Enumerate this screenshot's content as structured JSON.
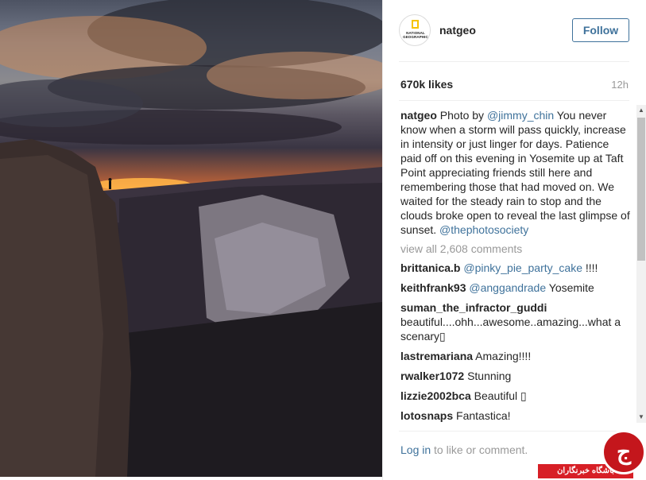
{
  "post": {
    "username": "natgeo",
    "avatar_label": "NATIONAL GEOGRAPHIC",
    "follow_label": "Follow",
    "likes": "670k likes",
    "time_ago": "12h"
  },
  "caption": {
    "username": "natgeo",
    "prefix": " Photo by ",
    "mention": "@jimmy_chin",
    "body": " You never know when a storm will pass quickly, increase in intensity or just linger for days. Patience paid off on this evening in Yosemite up at Taft Point appreciating friends still here and remembering those that had moved on. We waited for the steady rain to stop and the clouds broke open to reveal the last glimpse of sunset. ",
    "tag": "@thephotosociety"
  },
  "view_all_comments": "view all 2,608 comments",
  "comments": [
    {
      "user": "brittanica.b",
      "mention": "@pinky_pie_party_cake",
      "text": " !!!!"
    },
    {
      "user": "keithfrank93",
      "mention": "@anggandrade",
      "text": " Yosemite"
    },
    {
      "user": "suman_the_infractor_guddi",
      "mention": "",
      "text": " beautiful....ohh...awesome..amazing...what a scenary▯"
    },
    {
      "user": "lastremariana",
      "mention": "",
      "text": " Amazing!!!!"
    },
    {
      "user": "rwalker1072",
      "mention": "",
      "text": " Stunning"
    },
    {
      "user": "lizzie2002bca",
      "mention": "",
      "text": " Beautiful ▯"
    },
    {
      "user": "lotosnaps",
      "mention": "",
      "text": " Fantastica!"
    }
  ],
  "footer": {
    "login_link": "Log in",
    "login_rest": " to like or comment."
  },
  "watermark": {
    "label": "باشگاه خبرنگاران",
    "glyph": "ج"
  },
  "colors": {
    "link": "#3f729b",
    "muted": "#999999",
    "watermark_red": "#d71f26"
  },
  "icons": {
    "scroll_up": "▲",
    "scroll_down": "▼"
  }
}
